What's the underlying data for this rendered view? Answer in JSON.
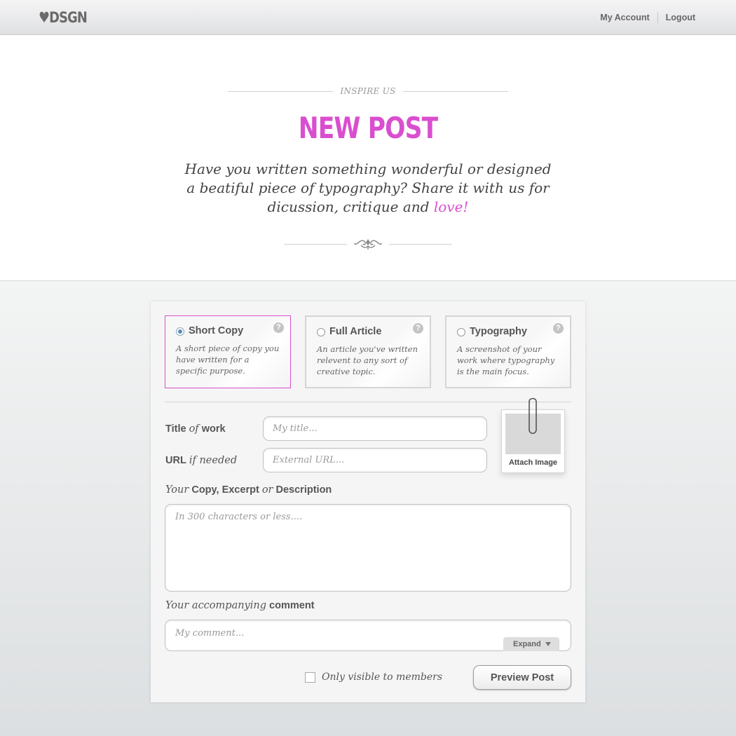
{
  "header": {
    "logo": "♥DSGN",
    "nav": [
      {
        "label": "My Account"
      },
      {
        "label": "Logout"
      }
    ]
  },
  "hero": {
    "kicker": "INSPIRE US",
    "title": "NEW POST",
    "intro_before": "Have you written something wonderful or designed a beatiful piece of typography? Share it with us for dicussion, critique and ",
    "intro_highlight": "love!",
    "accent_color": "#d94ecf"
  },
  "post_types": [
    {
      "label": "Short Copy",
      "description": "A short piece of copy you have written for a specific purpose.",
      "selected": true
    },
    {
      "label": "Full Article",
      "description": "An article you've written relevent to any sort of creative topic.",
      "selected": false
    },
    {
      "label": "Typography",
      "description": "A screenshot of your work where typography is the main focus.",
      "selected": false
    }
  ],
  "help_symbol": "?",
  "form": {
    "title_label_strong1": "Title",
    "title_label_italic": "of",
    "title_label_strong2": "work",
    "title_placeholder": "My title...",
    "url_label_strong": "URL",
    "url_label_italic": "if needed",
    "url_placeholder": "External URL...",
    "attach_label": "Attach Image",
    "copy_label_italic1": "Your",
    "copy_label_strong1": "Copy, Excerpt",
    "copy_label_italic2": "or",
    "copy_label_strong2": "Description",
    "copy_placeholder": "In 300 characters or less....",
    "comment_label_italic": "Your accompanying",
    "comment_label_strong": "comment",
    "comment_placeholder": "My comment...",
    "expand_label": "Expand",
    "members_only_label": "Only visible to members",
    "members_only_checked": false,
    "submit_label": "Preview Post"
  }
}
